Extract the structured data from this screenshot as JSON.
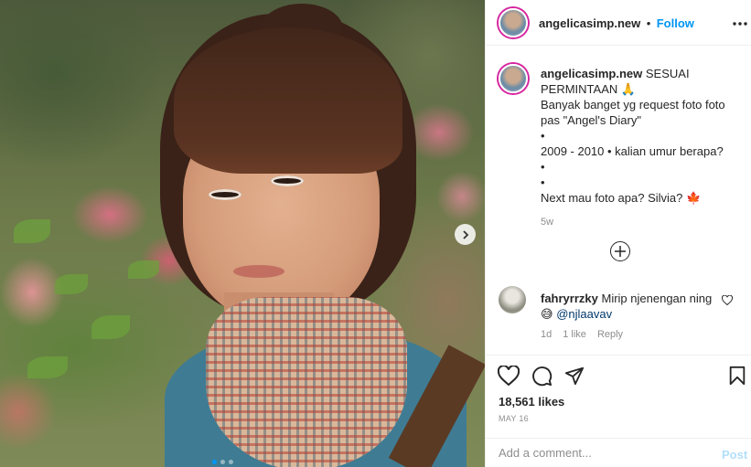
{
  "photo": {
    "carousel_dots": 3,
    "active_dot": 1
  },
  "header": {
    "username": "angelicasimp.new",
    "separator": "•",
    "follow_label": "Follow",
    "more_icon": "ellipsis-icon"
  },
  "caption": {
    "username": "angelicasimp.new",
    "line1": "SESUAI PERMINTAAN",
    "line1_emoji": "🙏",
    "line2": "Banyak banget yg request foto foto pas \"Angel's Diary\"",
    "bullet": "•",
    "line3": "2009 - 2010 • kalian umur berapa?",
    "line4": "Next mau foto apa? Silvia?",
    "line4_emoji": "🍁",
    "age": "5w"
  },
  "comment": {
    "username": "fahryrrzky",
    "text_before": "Mirip njenengan ning",
    "emoji": "😅",
    "mention": "@njlaavav",
    "age": "1d",
    "likes": "1 like",
    "reply_label": "Reply"
  },
  "actions": {
    "likes": "18,561 likes",
    "date": "MAY 16"
  },
  "add_comment": {
    "placeholder": "Add a comment...",
    "post_label": "Post"
  },
  "colors": {
    "accent": "#0095f6",
    "text": "#262626",
    "muted": "#8e8e8e",
    "border": "#efefef"
  }
}
